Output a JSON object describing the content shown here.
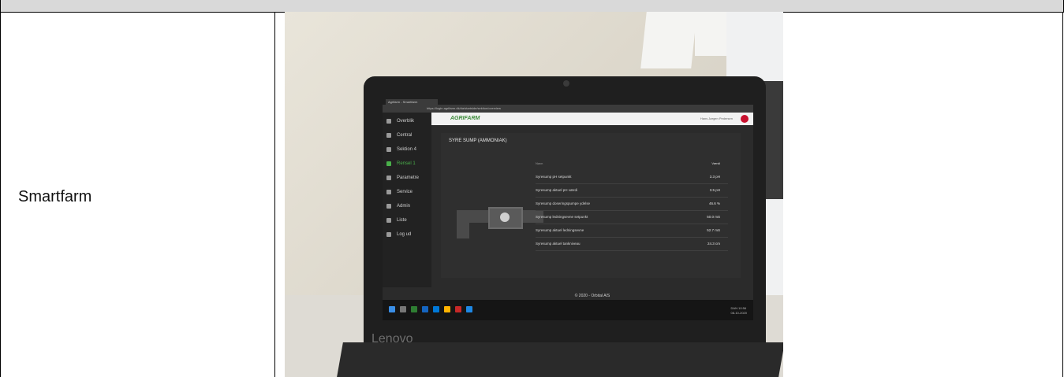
{
  "row": {
    "label": "Smartfarm"
  },
  "photo": {
    "laptop_brand": "Lenovo",
    "browser": {
      "tab_title": "Agrifarm - Smartfarm",
      "url": "https://login.agrifarm.dk/da/startside/sektion/overview"
    },
    "app": {
      "logo": "AGRIFARM",
      "user": "Hans Jørgen Pedersen",
      "sidebar_items": [
        {
          "label": "Overblik",
          "icon": "grid-icon"
        },
        {
          "label": "Central",
          "icon": "layers-icon"
        },
        {
          "label": "Sektion 4",
          "icon": "layers-icon"
        },
        {
          "label": "Rensel 1",
          "icon": "dot-icon",
          "active": true
        },
        {
          "label": "Parametre",
          "icon": "gear-icon"
        },
        {
          "label": "Service",
          "icon": "wrench-icon"
        },
        {
          "label": "Admin",
          "icon": "users-icon"
        },
        {
          "label": "Liste",
          "icon": "list-icon"
        },
        {
          "label": "Log ud",
          "icon": "logout-icon"
        }
      ],
      "panel_title": "SYRE SUMP (AMMONIAK)",
      "table_headers": {
        "name": "Navn",
        "value": "Værdi"
      },
      "rows": [
        {
          "name": "Syresump pH setpunkt",
          "value": "3.3 pH"
        },
        {
          "name": "Syresump aktuel pH værdi",
          "value": "3.5 pH"
        },
        {
          "name": "Syresump doseringspumpe ydelse",
          "value": "46.6 %"
        },
        {
          "name": "Syresump ledningsevne setpunkt",
          "value": "50.0 mS"
        },
        {
          "name": "Syresump aktuel ledningsevne",
          "value": "52.7 mS"
        },
        {
          "name": "Syresump aktuel tankniveau",
          "value": "24.3 cm"
        }
      ],
      "footer": "© 2020 - Orbital A/S",
      "taskbar": {
        "time": "10:56",
        "date": "08-10-2020",
        "lang": "DAN"
      }
    }
  }
}
